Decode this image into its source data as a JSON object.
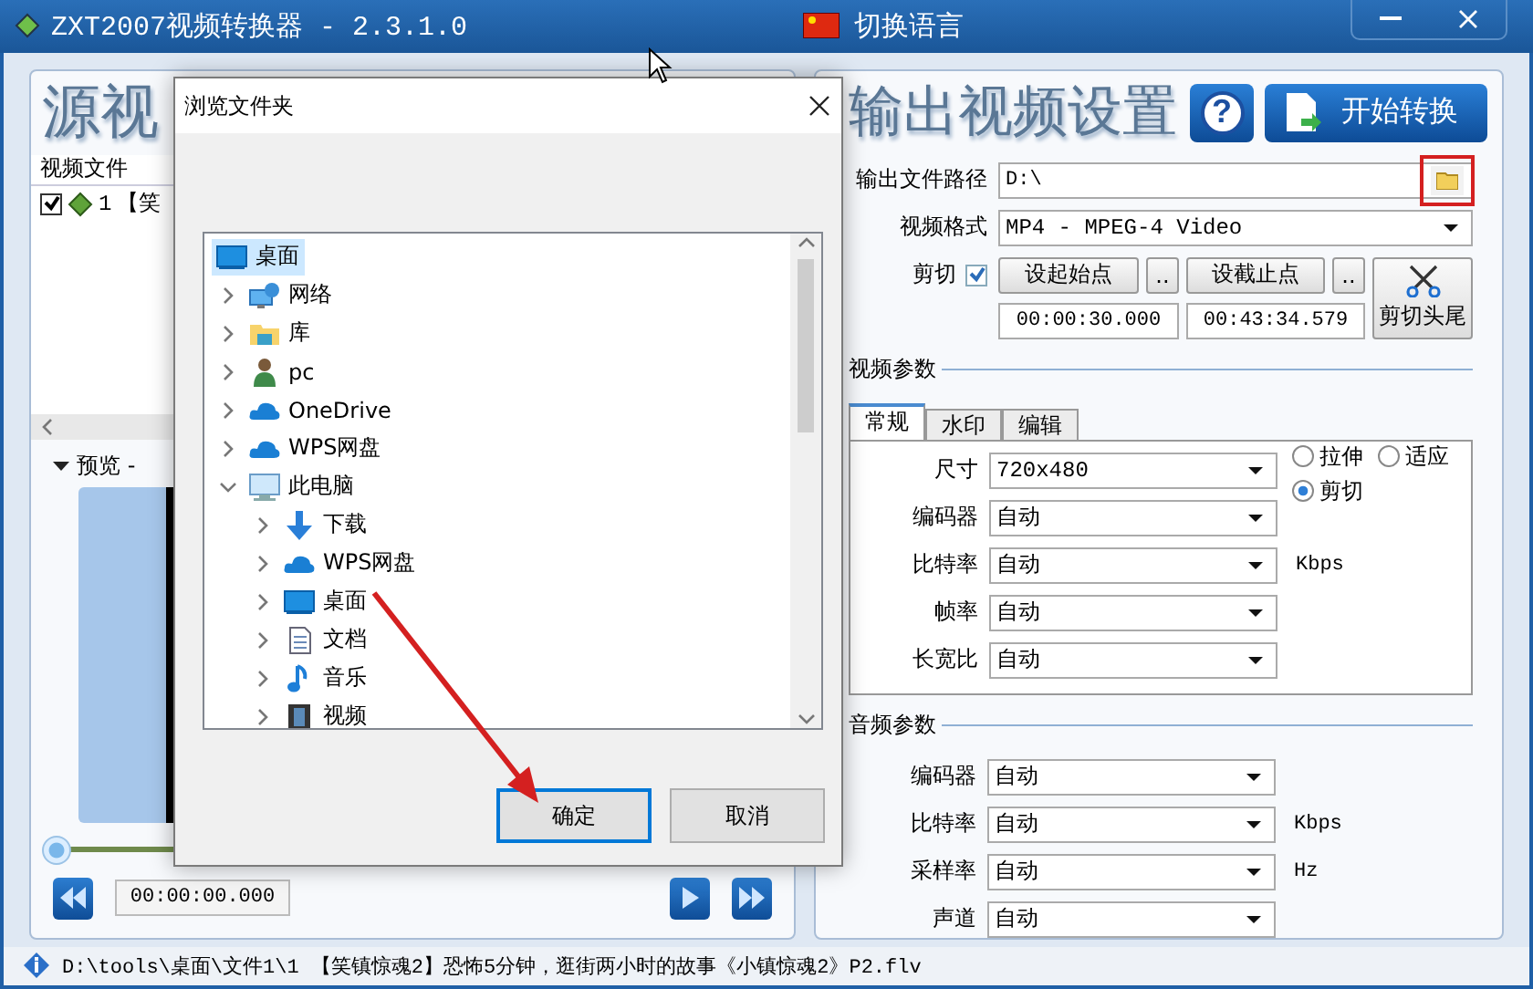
{
  "window": {
    "title": "ZXT2007视频转换器 - 2.3.1.0",
    "language_button": "切换语言"
  },
  "source_panel": {
    "heading": "源视",
    "list_header": "视频文件",
    "files": [
      {
        "checked": true,
        "index": "1",
        "name": "【笑"
      }
    ],
    "preview_label": "预览 -",
    "preview_expanded": true,
    "slider": {
      "level": 0
    },
    "time": "00:00:00.000"
  },
  "output_panel": {
    "heading": "输出视频设置",
    "help_button": "?",
    "start_button": "开始转换",
    "path": {
      "label": "输出文件路径",
      "value": "D:\\"
    },
    "format": {
      "label": "视频格式",
      "value": "MP4 - MPEG-4 Video"
    },
    "cut": {
      "label": "剪切",
      "checked": true,
      "start_button": "设起始点",
      "start_more": "..",
      "end_button": "设截止点",
      "end_more": "..",
      "start_time": "00:00:30.000",
      "end_time": "00:43:34.579",
      "trim_button": "剪切头尾"
    },
    "video_params": {
      "title": "视频参数",
      "tabs": [
        {
          "label": "常规",
          "selected": true
        },
        {
          "label": "水印",
          "selected": false
        },
        {
          "label": "编辑",
          "selected": false
        }
      ],
      "size": {
        "label": "尺寸",
        "value": "720x480"
      },
      "scale_options": [
        {
          "label": "拉伸",
          "selected": false
        },
        {
          "label": "适应",
          "selected": false
        },
        {
          "label": "剪切",
          "selected": true
        }
      ],
      "fields": [
        {
          "label": "编码器",
          "value": "自动"
        },
        {
          "label": "比特率",
          "value": "自动",
          "unit": "Kbps"
        },
        {
          "label": "帧率",
          "value": "自动"
        },
        {
          "label": "长宽比",
          "value": "自动"
        }
      ]
    },
    "audio_params": {
      "title": "音频参数",
      "fields": [
        {
          "label": "编码器",
          "value": "自动"
        },
        {
          "label": "比特率",
          "value": "自动",
          "unit": "Kbps"
        },
        {
          "label": "采样率",
          "value": "自动",
          "unit": "Hz"
        },
        {
          "label": "声道",
          "value": "自动"
        }
      ]
    }
  },
  "status_bar": {
    "text": "D:\\tools\\桌面\\文件1\\1 【笑镇惊魂2】恐怖5分钟，逛街两小时的故事《小镇惊魂2》P2.flv"
  },
  "dialog": {
    "title": "浏览文件夹",
    "tree": [
      {
        "label": "桌面",
        "kind": "desktop",
        "selected": true,
        "children": [
          {
            "label": "网络",
            "kind": "network",
            "selected": false,
            "expanded": false
          },
          {
            "label": "库",
            "kind": "library",
            "selected": false,
            "expanded": false
          },
          {
            "label": "pc",
            "kind": "user",
            "selected": false,
            "expanded": false
          },
          {
            "label": "OneDrive",
            "kind": "cloud",
            "selected": false,
            "expanded": false
          },
          {
            "label": "WPS网盘",
            "kind": "cloud",
            "selected": false,
            "expanded": false
          },
          {
            "label": "此电脑",
            "kind": "computer",
            "selected": false,
            "expanded": true,
            "children": [
              {
                "label": "下载",
                "kind": "download",
                "selected": false,
                "expanded": false
              },
              {
                "label": "WPS网盘",
                "kind": "cloud",
                "selected": false,
                "expanded": false
              },
              {
                "label": "桌面",
                "kind": "desktop",
                "selected": false,
                "expanded": false
              },
              {
                "label": "文档",
                "kind": "document",
                "selected": false,
                "expanded": false
              },
              {
                "label": "音乐",
                "kind": "music",
                "selected": false,
                "expanded": false
              },
              {
                "label": "视频",
                "kind": "video",
                "selected": false,
                "expanded": false
              }
            ]
          }
        ]
      }
    ],
    "buttons": [
      {
        "label": "确定",
        "focused": true
      },
      {
        "label": "取消",
        "focused": false
      }
    ]
  }
}
